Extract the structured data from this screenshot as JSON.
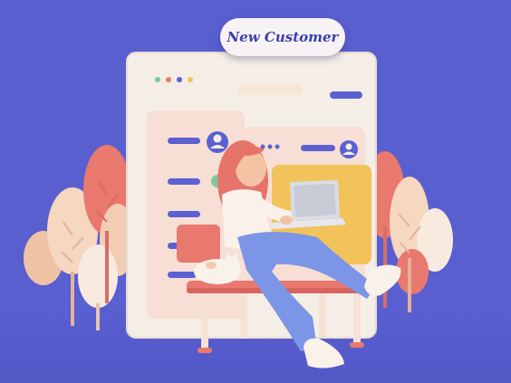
{
  "badge": {
    "label": "New Customer"
  },
  "colors": {
    "background": "#5a5fd0",
    "panel": "#f4eee6",
    "accent_pink": "#e9827a",
    "accent_blue": "#5b60d2",
    "accent_yellow": "#f2c35a",
    "jeans": "#7d95e6",
    "hair": "#e6746a"
  },
  "icons": [
    "avatar-icon",
    "avatar-icon",
    "laptop-icon"
  ]
}
